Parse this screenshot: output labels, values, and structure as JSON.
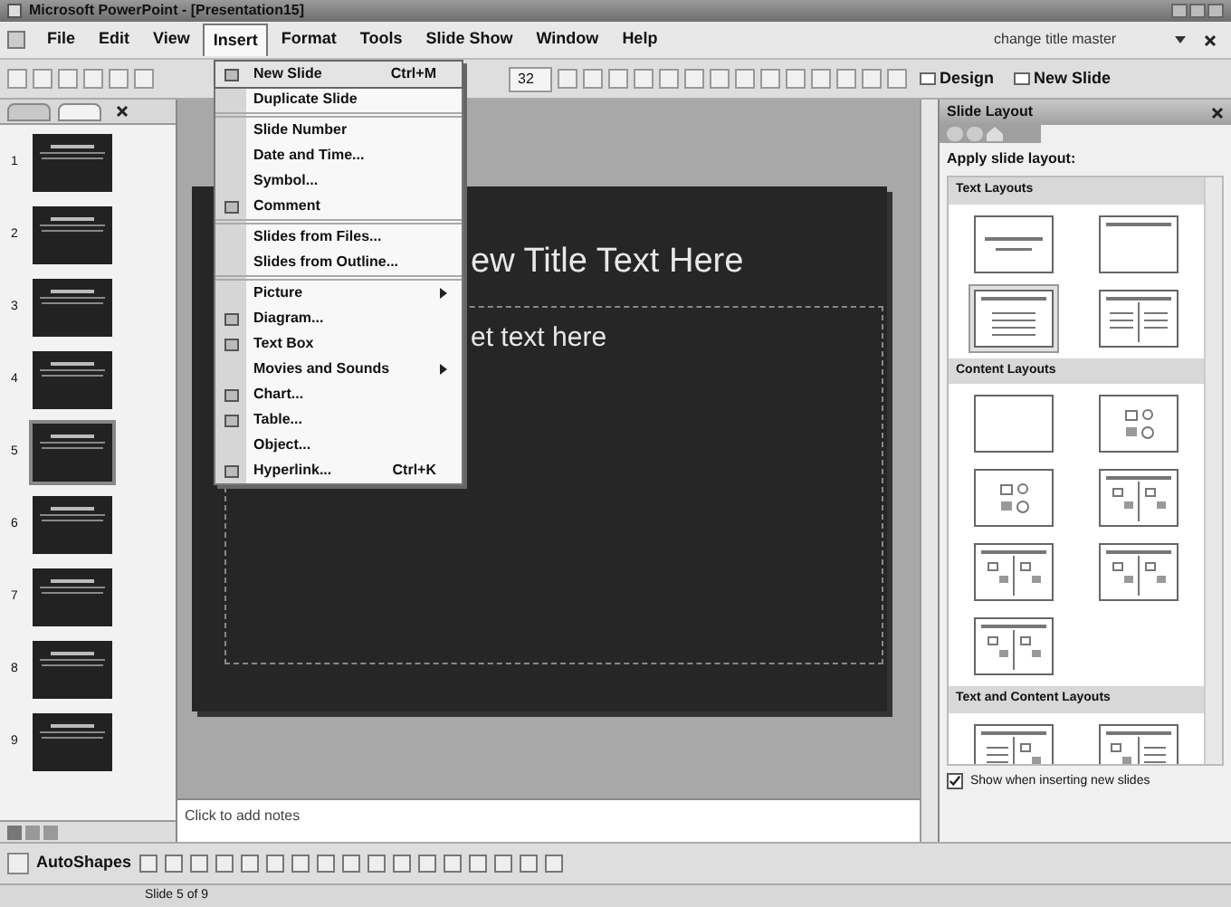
{
  "window": {
    "title": "Microsoft PowerPoint - [Presentation15]"
  },
  "menu_bar": {
    "items": [
      {
        "label": "File",
        "selected": false
      },
      {
        "label": "Edit",
        "selected": false
      },
      {
        "label": "View",
        "selected": false
      },
      {
        "label": "Insert",
        "selected": true
      },
      {
        "label": "Format",
        "selected": false
      },
      {
        "label": "Tools",
        "selected": false
      },
      {
        "label": "Slide Show",
        "selected": false
      },
      {
        "label": "Window",
        "selected": false
      },
      {
        "label": "Help",
        "selected": false
      }
    ],
    "help_box": "change title master"
  },
  "toolbar": {
    "font_size": "32",
    "design_button": "Design",
    "new_slide_button": "New Slide"
  },
  "insert_menu": [
    {
      "label": "New Slide",
      "shortcut": "Ctrl+M",
      "icon": true,
      "selected": true,
      "submenu": false,
      "separator_before": false
    },
    {
      "label": "Duplicate Slide",
      "icon": false,
      "selected": false,
      "submenu": false,
      "separator_before": false
    },
    {
      "label": "Slide Number",
      "icon": false,
      "selected": false,
      "submenu": false,
      "separator_before": true
    },
    {
      "label": "Date and Time...",
      "icon": false,
      "selected": false,
      "submenu": false,
      "separator_before": false
    },
    {
      "label": "Symbol...",
      "icon": false,
      "selected": false,
      "submenu": false,
      "separator_before": false
    },
    {
      "label": "Comment",
      "icon": true,
      "selected": false,
      "submenu": false,
      "separator_before": false
    },
    {
      "label": "Slides from Files...",
      "icon": false,
      "selected": false,
      "submenu": false,
      "separator_before": true
    },
    {
      "label": "Slides from Outline...",
      "icon": false,
      "selected": false,
      "submenu": false,
      "separator_before": false
    },
    {
      "label": "Picture",
      "icon": false,
      "selected": false,
      "submenu": true,
      "separator_before": true
    },
    {
      "label": "Diagram...",
      "icon": true,
      "selected": false,
      "submenu": false,
      "separator_before": false
    },
    {
      "label": "Text Box",
      "icon": true,
      "selected": false,
      "submenu": false,
      "separator_before": false
    },
    {
      "label": "Movies and Sounds",
      "icon": false,
      "selected": false,
      "submenu": true,
      "separator_before": false
    },
    {
      "label": "Chart...",
      "icon": true,
      "selected": false,
      "submenu": false,
      "separator_before": false
    },
    {
      "label": "Table...",
      "icon": true,
      "selected": false,
      "submenu": false,
      "separator_before": false
    },
    {
      "label": "Object...",
      "icon": false,
      "selected": false,
      "submenu": false,
      "separator_before": false
    },
    {
      "label": "Hyperlink...",
      "shortcut": "Ctrl+K",
      "icon": true,
      "selected": false,
      "submenu": false,
      "separator_before": false
    }
  ],
  "slides": [
    {
      "number": "1",
      "selected": false
    },
    {
      "number": "2",
      "selected": false
    },
    {
      "number": "3",
      "selected": false
    },
    {
      "number": "4",
      "selected": false
    },
    {
      "number": "5",
      "selected": true
    },
    {
      "number": "6",
      "selected": false
    },
    {
      "number": "7",
      "selected": false
    },
    {
      "number": "8",
      "selected": false
    },
    {
      "number": "9",
      "selected": false
    }
  ],
  "slide": {
    "title": "ew Title Text Here",
    "body": "et text here"
  },
  "notes": {
    "placeholder": "Click to add notes"
  },
  "task_pane": {
    "title": "Slide Layout",
    "heading": "Apply slide layout:",
    "sections": [
      {
        "title": "Text Layouts",
        "layouts": [
          {
            "kind": "title",
            "selected": false
          },
          {
            "kind": "title-only",
            "selected": false
          },
          {
            "kind": "text",
            "selected": true
          },
          {
            "kind": "two-text",
            "selected": false
          }
        ]
      },
      {
        "title": "Content Layouts",
        "layouts": [
          {
            "kind": "blank",
            "selected": false
          },
          {
            "kind": "content",
            "selected": false
          },
          {
            "kind": "content",
            "selected": false
          },
          {
            "kind": "two-content",
            "selected": false
          },
          {
            "kind": "two-content",
            "selected": false
          },
          {
            "kind": "two-content",
            "selected": false
          },
          {
            "kind": "two-content",
            "selected": false
          }
        ]
      },
      {
        "title": "Text and Content Layouts",
        "layouts": [
          {
            "kind": "text-content",
            "selected": false
          },
          {
            "kind": "content-text",
            "selected": false
          }
        ]
      }
    ],
    "show_when_inserting": {
      "label": "Show when inserting new slides",
      "checked": true
    }
  },
  "drawing_toolbar": {
    "autoshapes": "AutoShapes"
  },
  "status_bar": {
    "slide": "Slide 5 of 9"
  }
}
